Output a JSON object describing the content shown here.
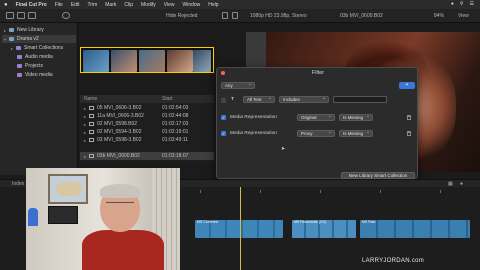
{
  "menubar": {
    "apple": "",
    "app": "Final Cut Pro",
    "items": [
      "File",
      "Edit",
      "Trim",
      "Mark",
      "Clip",
      "Modify",
      "View",
      "Window",
      "Help"
    ]
  },
  "toolbar": {
    "hide_rejected": "Hide Rejected",
    "format": "1080p HD 23.98p, Stereo",
    "clip_name": "03b MVI_0600.B02",
    "zoom": "84%",
    "view": "View"
  },
  "sidebar": {
    "items": [
      {
        "label": "New Library",
        "indent": 0
      },
      {
        "label": "Drama v2",
        "indent": 0
      },
      {
        "label": "Smart Collections",
        "indent": 1
      },
      {
        "label": "Audio media",
        "indent": 1
      },
      {
        "label": "Projects",
        "indent": 1
      },
      {
        "label": "Video media",
        "indent": 1
      }
    ]
  },
  "browser": {
    "columns": [
      "Name",
      "Start"
    ],
    "rows": [
      {
        "name": "05 MVI_0606-3.B02",
        "start": "01:02:54:03"
      },
      {
        "name": "11a MVI_0606-3.B02",
        "start": "01:02:44:08"
      },
      {
        "name": "02 MVI_0598.B02",
        "start": "01:02:17:03"
      },
      {
        "name": "02 MVI_0594-3.B02",
        "start": "01:02:19:01"
      },
      {
        "name": "03 MVI_0598-3.B02",
        "start": "01:03:49:11"
      },
      {
        "name": "03b MVI_0600.B02",
        "start": "01:03:18:07"
      }
    ]
  },
  "filter": {
    "title": "Filter",
    "match": "Any",
    "plus": "+",
    "text_row": {
      "field": "All Text",
      "op": "Includes",
      "value": ""
    },
    "rules": [
      {
        "label": "Media Representation",
        "value": "Original",
        "op": "Is Missing"
      },
      {
        "label": "Media Representation",
        "value": "Proxy",
        "op": "Is Missing"
      }
    ],
    "new_collection": "New Library Smart Collection"
  },
  "timeline": {
    "index": "Index",
    "clips": [
      "MS Cornered",
      "MS Pavements (2:0)",
      "MS Rain"
    ]
  },
  "watermark": "LARRYJORDAN.com",
  "colors": {
    "accent": "#3c76d6",
    "selection_border": "#ffd000",
    "clip_blue": "#3e86b8",
    "shirt_red": "#a8281f"
  }
}
